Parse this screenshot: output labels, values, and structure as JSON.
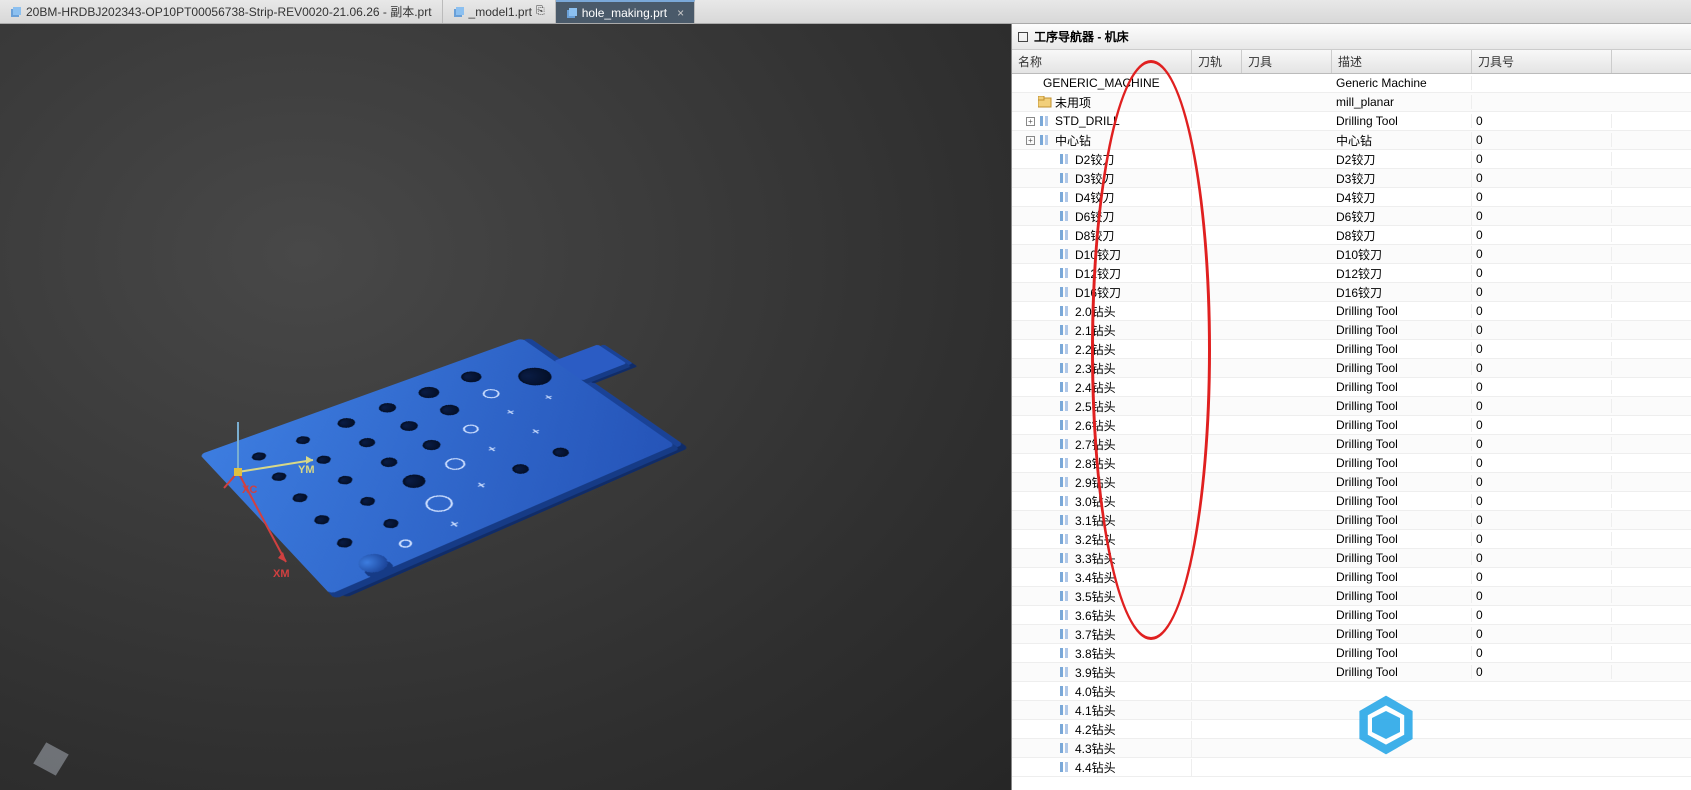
{
  "tabs": [
    {
      "label": "20BM-HRDBJ202343-OP10PT00056738-Strip-REV0020-21.06.26 - 副本.prt",
      "dirty": "",
      "close": "",
      "active": false
    },
    {
      "label": "_model1.prt",
      "dirty": "⎘",
      "close": "",
      "active": false
    },
    {
      "label": "hole_making.prt",
      "dirty": "",
      "close": "×",
      "active": true
    }
  ],
  "panel": {
    "title": "工序导航器 - 机床"
  },
  "columns": {
    "name": "名称",
    "track": "刀轨",
    "tool": "刀具",
    "desc": "描述",
    "toolno": "刀具号"
  },
  "axis": {
    "ym": "YM",
    "xc": "XC",
    "xm": "XM"
  },
  "tree": [
    {
      "indent": 0,
      "exp": "",
      "icon": "machine",
      "label": "GENERIC_MACHINE",
      "track": "",
      "tool": "",
      "desc": "Generic Machine",
      "toolno": ""
    },
    {
      "indent": 1,
      "exp": "",
      "icon": "folder",
      "label": "未用项",
      "track": "",
      "tool": "",
      "desc": "mill_planar",
      "toolno": ""
    },
    {
      "indent": 1,
      "exp": "+",
      "icon": "tool",
      "label": "STD_DRILL",
      "track": "",
      "tool": "",
      "desc": "Drilling Tool",
      "toolno": "0"
    },
    {
      "indent": 1,
      "exp": "+",
      "icon": "tool",
      "label": "中心钻",
      "track": "",
      "tool": "",
      "desc": "中心钻",
      "toolno": "0"
    },
    {
      "indent": 2,
      "exp": "",
      "icon": "tool",
      "label": "D2铰刀",
      "track": "",
      "tool": "",
      "desc": "D2铰刀",
      "toolno": "0"
    },
    {
      "indent": 2,
      "exp": "",
      "icon": "tool",
      "label": "D3铰刀",
      "track": "",
      "tool": "",
      "desc": "D3铰刀",
      "toolno": "0"
    },
    {
      "indent": 2,
      "exp": "",
      "icon": "tool",
      "label": "D4铰刀",
      "track": "",
      "tool": "",
      "desc": "D4铰刀",
      "toolno": "0"
    },
    {
      "indent": 2,
      "exp": "",
      "icon": "tool",
      "label": "D6铰刀",
      "track": "",
      "tool": "",
      "desc": "D6铰刀",
      "toolno": "0"
    },
    {
      "indent": 2,
      "exp": "",
      "icon": "tool",
      "label": "D8铰刀",
      "track": "",
      "tool": "",
      "desc": "D8铰刀",
      "toolno": "0"
    },
    {
      "indent": 2,
      "exp": "",
      "icon": "tool",
      "label": "D10铰刀",
      "track": "",
      "tool": "",
      "desc": "D10铰刀",
      "toolno": "0"
    },
    {
      "indent": 2,
      "exp": "",
      "icon": "tool",
      "label": "D12铰刀",
      "track": "",
      "tool": "",
      "desc": "D12铰刀",
      "toolno": "0"
    },
    {
      "indent": 2,
      "exp": "",
      "icon": "tool",
      "label": "D16铰刀",
      "track": "",
      "tool": "",
      "desc": "D16铰刀",
      "toolno": "0"
    },
    {
      "indent": 2,
      "exp": "",
      "icon": "tool",
      "label": "2.0钻头",
      "track": "",
      "tool": "",
      "desc": "Drilling Tool",
      "toolno": "0"
    },
    {
      "indent": 2,
      "exp": "",
      "icon": "tool",
      "label": "2.1钻头",
      "track": "",
      "tool": "",
      "desc": "Drilling Tool",
      "toolno": "0"
    },
    {
      "indent": 2,
      "exp": "",
      "icon": "tool",
      "label": "2.2钻头",
      "track": "",
      "tool": "",
      "desc": "Drilling Tool",
      "toolno": "0"
    },
    {
      "indent": 2,
      "exp": "",
      "icon": "tool",
      "label": "2.3钻头",
      "track": "",
      "tool": "",
      "desc": "Drilling Tool",
      "toolno": "0"
    },
    {
      "indent": 2,
      "exp": "",
      "icon": "tool",
      "label": "2.4钻头",
      "track": "",
      "tool": "",
      "desc": "Drilling Tool",
      "toolno": "0"
    },
    {
      "indent": 2,
      "exp": "",
      "icon": "tool",
      "label": "2.5钻头",
      "track": "",
      "tool": "",
      "desc": "Drilling Tool",
      "toolno": "0"
    },
    {
      "indent": 2,
      "exp": "",
      "icon": "tool",
      "label": "2.6钻头",
      "track": "",
      "tool": "",
      "desc": "Drilling Tool",
      "toolno": "0"
    },
    {
      "indent": 2,
      "exp": "",
      "icon": "tool",
      "label": "2.7钻头",
      "track": "",
      "tool": "",
      "desc": "Drilling Tool",
      "toolno": "0"
    },
    {
      "indent": 2,
      "exp": "",
      "icon": "tool",
      "label": "2.8钻头",
      "track": "",
      "tool": "",
      "desc": "Drilling Tool",
      "toolno": "0"
    },
    {
      "indent": 2,
      "exp": "",
      "icon": "tool",
      "label": "2.9钻头",
      "track": "",
      "tool": "",
      "desc": "Drilling Tool",
      "toolno": "0"
    },
    {
      "indent": 2,
      "exp": "",
      "icon": "tool",
      "label": "3.0钻头",
      "track": "",
      "tool": "",
      "desc": "Drilling Tool",
      "toolno": "0"
    },
    {
      "indent": 2,
      "exp": "",
      "icon": "tool",
      "label": "3.1钻头",
      "track": "",
      "tool": "",
      "desc": "Drilling Tool",
      "toolno": "0"
    },
    {
      "indent": 2,
      "exp": "",
      "icon": "tool",
      "label": "3.2钻头",
      "track": "",
      "tool": "",
      "desc": "Drilling Tool",
      "toolno": "0"
    },
    {
      "indent": 2,
      "exp": "",
      "icon": "tool",
      "label": "3.3钻头",
      "track": "",
      "tool": "",
      "desc": "Drilling Tool",
      "toolno": "0"
    },
    {
      "indent": 2,
      "exp": "",
      "icon": "tool",
      "label": "3.4钻头",
      "track": "",
      "tool": "",
      "desc": "Drilling Tool",
      "toolno": "0"
    },
    {
      "indent": 2,
      "exp": "",
      "icon": "tool",
      "label": "3.5钻头",
      "track": "",
      "tool": "",
      "desc": "Drilling Tool",
      "toolno": "0"
    },
    {
      "indent": 2,
      "exp": "",
      "icon": "tool",
      "label": "3.6钻头",
      "track": "",
      "tool": "",
      "desc": "Drilling Tool",
      "toolno": "0"
    },
    {
      "indent": 2,
      "exp": "",
      "icon": "tool",
      "label": "3.7钻头",
      "track": "",
      "tool": "",
      "desc": "Drilling Tool",
      "toolno": "0"
    },
    {
      "indent": 2,
      "exp": "",
      "icon": "tool",
      "label": "3.8钻头",
      "track": "",
      "tool": "",
      "desc": "Drilling Tool",
      "toolno": "0"
    },
    {
      "indent": 2,
      "exp": "",
      "icon": "tool",
      "label": "3.9钻头",
      "track": "",
      "tool": "",
      "desc": "Drilling Tool",
      "toolno": "0"
    },
    {
      "indent": 2,
      "exp": "",
      "icon": "tool",
      "label": "4.0钻头",
      "track": "",
      "tool": "",
      "desc": "",
      "toolno": ""
    },
    {
      "indent": 2,
      "exp": "",
      "icon": "tool",
      "label": "4.1钻头",
      "track": "",
      "tool": "",
      "desc": "",
      "toolno": ""
    },
    {
      "indent": 2,
      "exp": "",
      "icon": "tool",
      "label": "4.2钻头",
      "track": "",
      "tool": "",
      "desc": "",
      "toolno": ""
    },
    {
      "indent": 2,
      "exp": "",
      "icon": "tool",
      "label": "4.3钻头",
      "track": "",
      "tool": "",
      "desc": "",
      "toolno": ""
    },
    {
      "indent": 2,
      "exp": "",
      "icon": "tool",
      "label": "4.4钻头",
      "track": "",
      "tool": "",
      "desc": "",
      "toolno": ""
    }
  ]
}
